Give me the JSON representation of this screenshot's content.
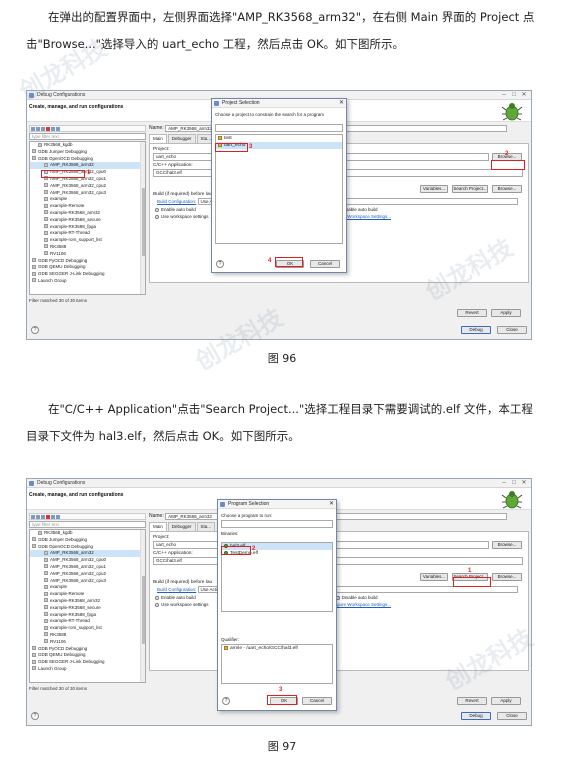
{
  "text": {
    "para1": "在弹出的配置界面中，左侧界面选择\"AMP_RK3568_arm32\"，在右侧 Main 界面的 Project 点击\"Browse...\"选择导入的 uart_echo 工程，然后点击 OK。如下图所示。",
    "caption1": "图 96",
    "para2": "在\"C/C++ Application\"点击\"Search Project...\"选择工程目录下需要调试的.elf 文件，本工程目录下文件为 hal3.elf，然后点击 OK。如下图所示。",
    "caption2": "图 97"
  },
  "watermark": "创龙科技",
  "dialog": {
    "title": "Debug Configurations",
    "header": "Create, manage, and run configurations",
    "filter_placeholder": "type filter text",
    "tree_items": [
      "RK3568_kgdb",
      "GDB Jumper Debugging",
      "GDB OpenOCD Debugging",
      "AMP_RK3568_arm32",
      "AMP_RK3568_arm32_cpu0",
      "AMP_RK3568_arm32_cpu1",
      "AMP_RK3568_arm32_cpu2",
      "AMP_RK3568_arm32_cpu3",
      "example",
      "example-Remote",
      "example-RK3568_arm32",
      "example-RK3568_secure",
      "example-RK3588_fpga",
      "example-RT-Thread",
      "example-rom_support_list",
      "RK3588",
      "RV1106",
      "GDB PyOCD Debugging",
      "GDB QEMU Debugging",
      "GDB SEGGER J-Link Debugging",
      "Launch Group"
    ],
    "filtered_text": "Filter matched 30 of 30 items",
    "name_label": "Name:",
    "name_value": "AMP_RK3568_arm32",
    "tabs": [
      "Main",
      "Debugger",
      "Sta..."
    ],
    "project_label": "Project:",
    "project_value": "uart_echo",
    "app_label": "C/C++ Application:",
    "app_value": "GCC/hal3.elf",
    "variables_btn": "Variables...",
    "search_btn": "Search Project...",
    "browse_btn": "Browse...",
    "build_label": "Build (if required) before lau",
    "build_config_link": "Build Configuration:",
    "build_config_value": "Use Acti",
    "enable_auto": "Enable auto build",
    "disable_auto": "Disable auto build",
    "use_workspace": "Use workspace settings",
    "configure_link": "Configure Workspace Settings...",
    "revert_btn": "Revert",
    "apply_btn": "Apply",
    "debug_btn": "Debug",
    "close_btn": "Close",
    "help": "?"
  },
  "popup1": {
    "title": "Project Selection",
    "prompt": "Choose a project to constrain the search for a program",
    "items": [
      "test",
      "uart_echo"
    ],
    "ok": "OK",
    "cancel": "Cancel"
  },
  "popup2": {
    "title": "Program Selection",
    "prompt": "Choose a program to run:",
    "binaries_label": "Binaries:",
    "binaries": [
      "hal3.elf",
      "TestDemo.elf"
    ],
    "qualifier_label": "Qualifier:",
    "qualifier": "armle - /uart_echo/GCC/hal3.elf",
    "ok": "OK",
    "cancel": "Cancel"
  },
  "markers": {
    "m1": "1",
    "m2": "2",
    "m3": "3",
    "m4": "4"
  },
  "colors": {
    "marker": "#e02020",
    "selection": "#cde3f7",
    "link": "#1f5fc0"
  }
}
